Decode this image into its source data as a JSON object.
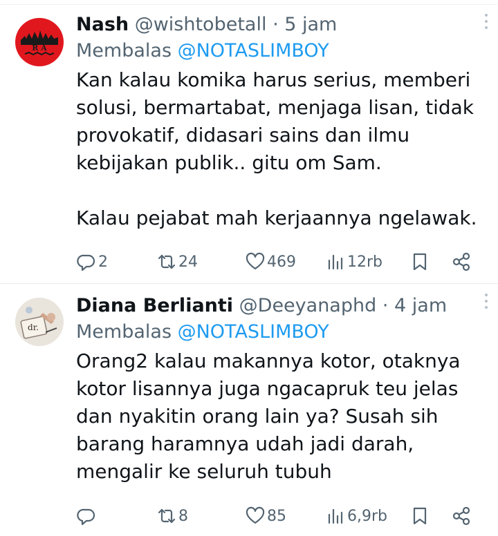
{
  "tweets": [
    {
      "name": "Nash",
      "handle": "@wishtobetall",
      "separator": "·",
      "time": "5 jam",
      "reply_prefix": "Membalas",
      "reply_to": "@NOTASLIMBOY",
      "body": "Kan kalau komika harus serius, memberi solusi, bermartabat, menjaga lisan, tidak provokatif, didasari sains dan ilmu kebijakan publik.. gitu om Sam.\n\nKalau pejabat mah kerjaannya ngelawak.",
      "avatar_text": "R  A",
      "counts": {
        "replies": "2",
        "retweets": "24",
        "likes": "469",
        "views": "12rb"
      }
    },
    {
      "name": "Diana Berlianti",
      "handle": "@Deeyanaphd",
      "separator": "·",
      "time": "4 jam",
      "reply_prefix": "Membalas",
      "reply_to": "@NOTASLIMBOY",
      "body": "Orang2 kalau makannya kotor, otaknya kotor lisannya juga ngacapruk teu jelas dan nyakitin orang lain ya? Susah sih barang haramnya udah jadi darah, mengalir ke seluruh tubuh",
      "avatar_text": "dr.",
      "counts": {
        "replies": "",
        "retweets": "8",
        "likes": "85",
        "views": "6,9rb"
      }
    }
  ],
  "icons": {
    "reply": "reply-icon",
    "retweet": "retweet-icon",
    "like": "heart-icon",
    "views": "views-icon",
    "bookmark": "bookmark-icon",
    "share": "share-icon",
    "more": "more-icon"
  },
  "colors": {
    "text": "#0f1419",
    "secondary": "#536471",
    "link": "#1d9bf0",
    "divider": "#e6ecf0",
    "avatar1_bg": "#e0181e"
  }
}
